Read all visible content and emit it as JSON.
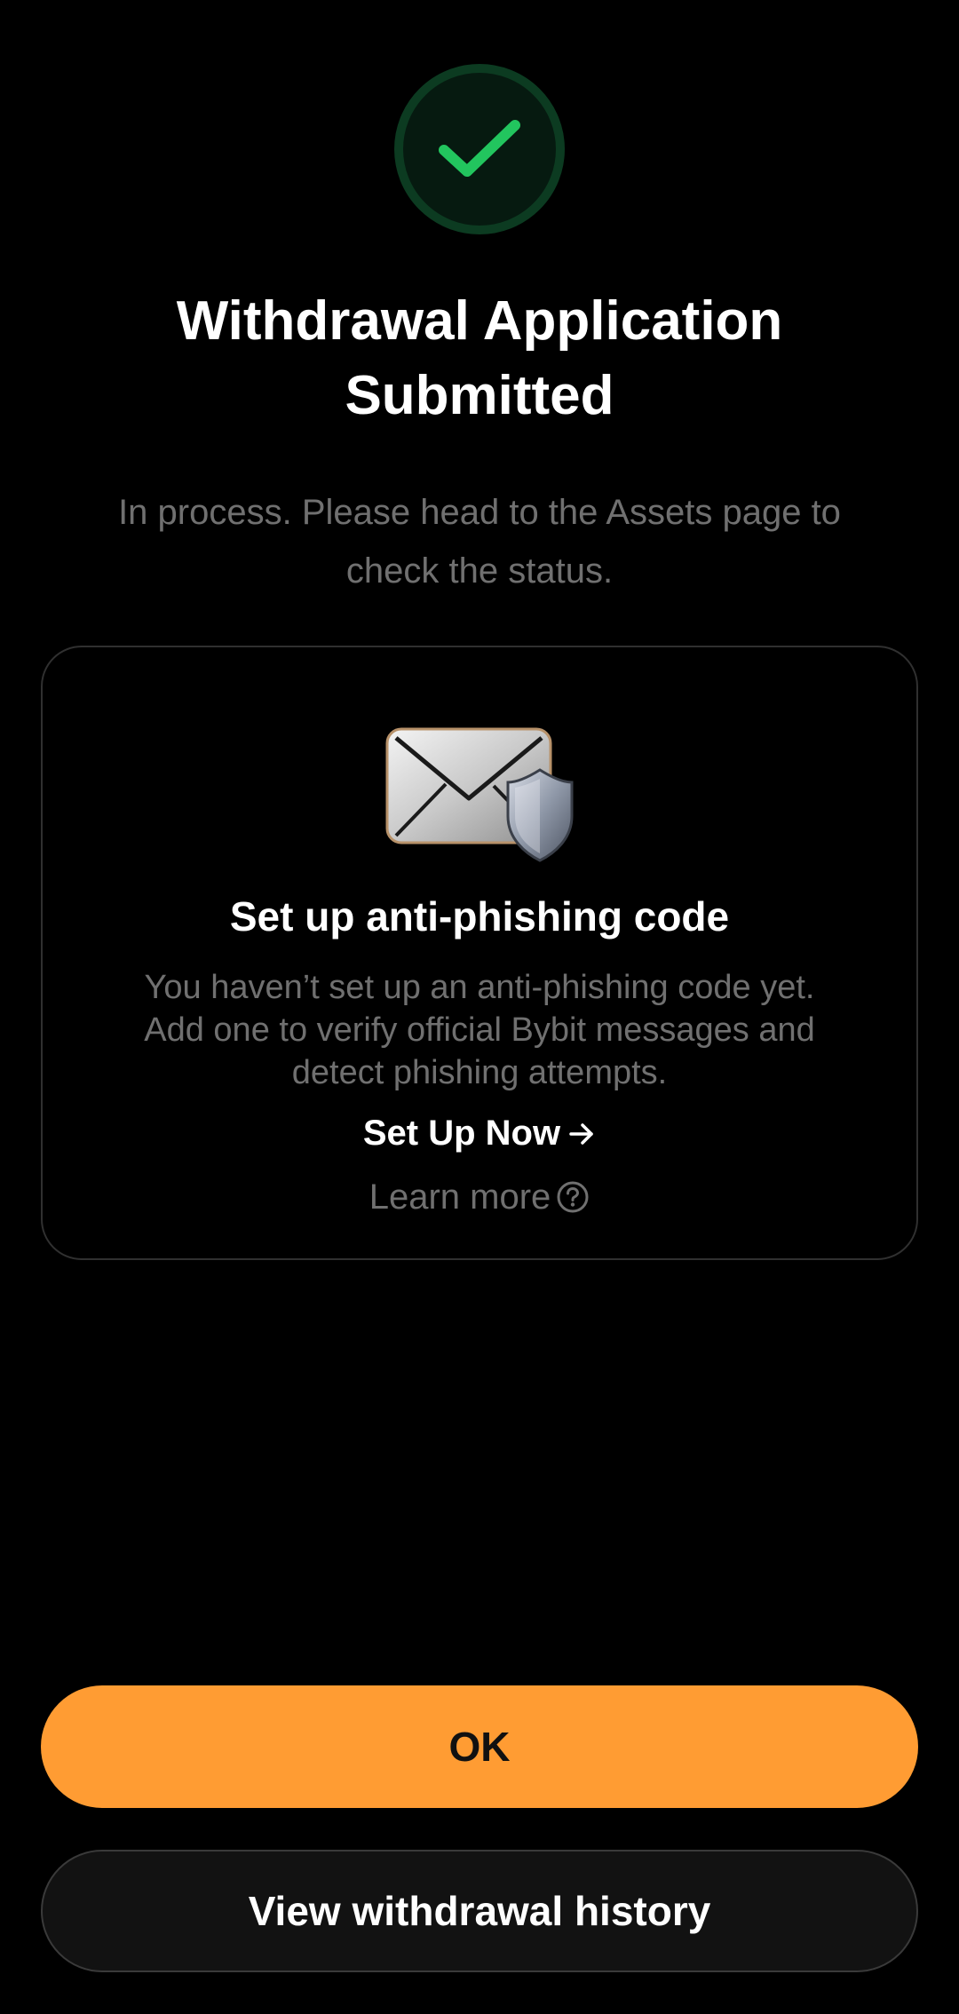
{
  "status": {
    "icon": "check-icon",
    "accent_color": "#22c55e",
    "title_lines": [
      "Withdrawal Application",
      "Submitted"
    ],
    "message": "In process. Please head to the Assets page to check the status."
  },
  "anti_phishing_card": {
    "illustration": "envelope-shield-icon",
    "title": "Set up anti-phishing code",
    "description_lines": [
      "You haven’t set up an anti-phishing code yet.",
      "Add one to verify official Bybit messages and",
      "detect phishing attempts."
    ],
    "setup_label": "Set Up Now",
    "setup_icon": "arrow-right-icon",
    "learn_more_label": "Learn more",
    "learn_more_icon": "question-circle-icon"
  },
  "actions": {
    "ok_label": "OK",
    "ok_color": "#ff9c33",
    "history_label": "View withdrawal history"
  }
}
